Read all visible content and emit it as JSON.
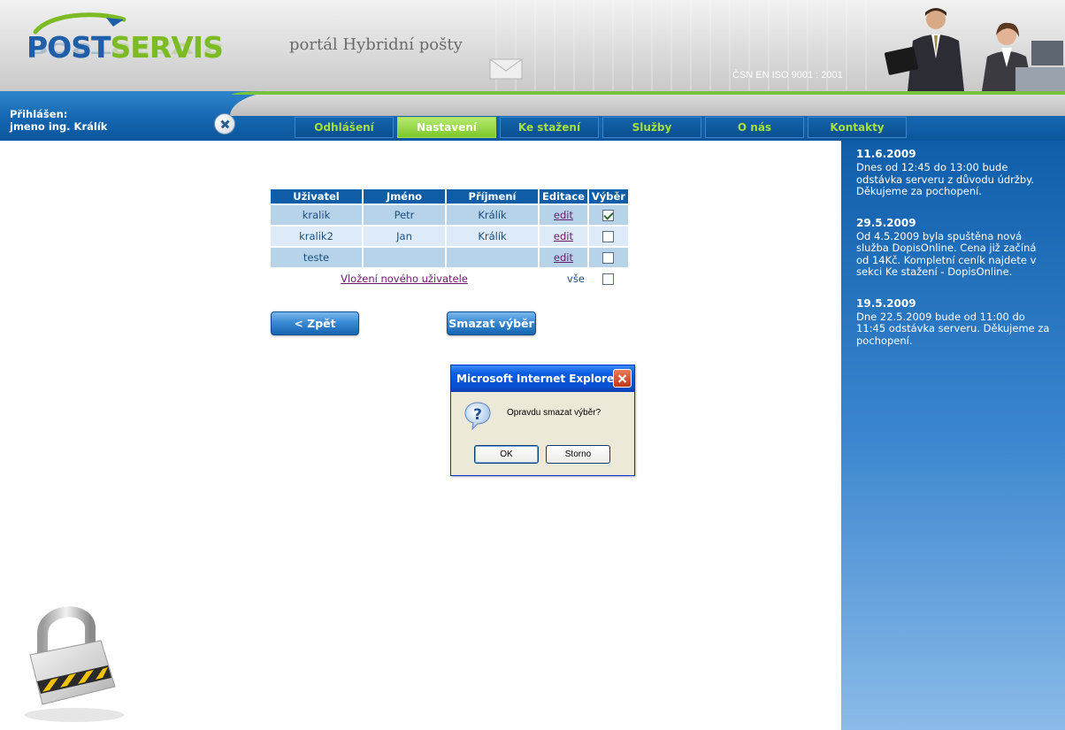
{
  "header": {
    "logo_part1": "POST",
    "logo_part2": "SERVIS",
    "portal_title": "portál Hybridní pošty",
    "iso": "ČSN EN ISO 9001 : 2001"
  },
  "user": {
    "line1": "Přihlášen:",
    "line2": "jmeno ing. Králík"
  },
  "nav": {
    "items": [
      {
        "label": "Odhlášení"
      },
      {
        "label": "Nastavení"
      },
      {
        "label": "Ke stažení"
      },
      {
        "label": "Služby"
      },
      {
        "label": "O nás"
      },
      {
        "label": "Kontakty"
      }
    ],
    "active": "Nastavení"
  },
  "table": {
    "headers": [
      "Uživatel",
      "Jméno",
      "Příjmení",
      "Editace",
      "Výběr"
    ],
    "rows": [
      {
        "user": "kralik",
        "first": "Petr",
        "last": "Králík",
        "edit": "edit",
        "checked": true
      },
      {
        "user": "kralik2",
        "first": "Jan",
        "last": "Králík",
        "edit": "edit",
        "checked": false
      },
      {
        "user": "teste",
        "first": "",
        "last": "",
        "edit": "edit",
        "checked": false
      }
    ],
    "add_user_link": "Vložení nového uživatele",
    "select_all_label": "vše"
  },
  "buttons": {
    "back": "< Zpět",
    "delete_selected": "Smazat výběr"
  },
  "dialog": {
    "title": "Microsoft Internet Explorer",
    "message": "Opravdu smazat výběr?",
    "ok": "OK",
    "cancel": "Storno"
  },
  "news": [
    {
      "date": "11.6.2009",
      "text": "Dnes od 12:45 do 13:00 bude odstávka serveru z důvodu údržby. Děkujeme za pochopení."
    },
    {
      "date": "29.5.2009",
      "text": "Od 4.5.2009 byla spuštěna nová služba DopisOnline. Cena již začíná od 14Kč. Kompletní ceník najdete v sekci Ke stažení - DopisOnline."
    },
    {
      "date": "19.5.2009",
      "text": "Dne 22.5.2009 bude od 11:00 do 11:45 odstávka serveru. Děkujeme za pochopení."
    }
  ],
  "colors": {
    "brand_blue": "#1f5ea8",
    "brand_green": "#7dbb24",
    "nav_text": "#a6e03c",
    "table_header": "#0f5da6"
  }
}
